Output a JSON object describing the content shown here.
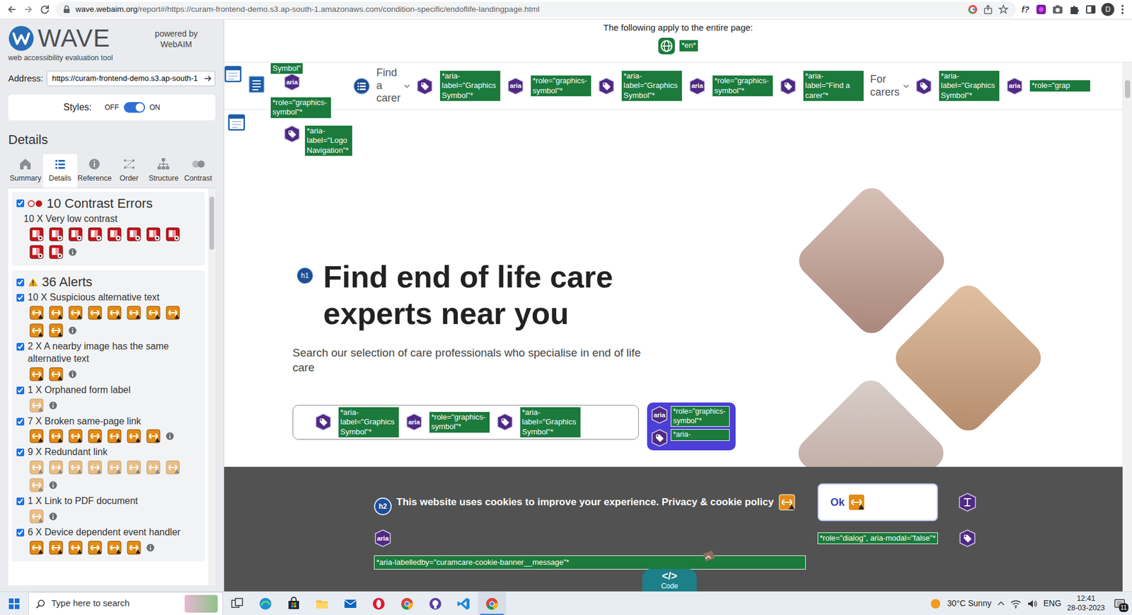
{
  "browser": {
    "url_host": "wave.webaim.org",
    "url_path": "/report#/https://curam-frontend-demo.s3.ap-south-1.amazonaws.com/condition-specific/endoflife-landingpage.html",
    "ext_label": "f?",
    "avatar": "D"
  },
  "wave": {
    "logo": "WAVE",
    "powered_by": "powered by",
    "webaim": "WebAIM",
    "tagline": "web accessibility evaluation tool",
    "address_label": "Address:",
    "address_value": "https://curam-frontend-demo.s3.ap-south-1",
    "styles_label": "Styles:",
    "styles_off": "OFF",
    "styles_on": "ON",
    "styles_enabled": true,
    "details_title": "Details",
    "tabs": [
      {
        "label": "Summary",
        "kind": "home",
        "selected": false
      },
      {
        "label": "Details",
        "kind": "list",
        "selected": true
      },
      {
        "label": "Reference",
        "kind": "info",
        "selected": false
      },
      {
        "label": "Order",
        "kind": "order",
        "selected": false
      },
      {
        "label": "Structure",
        "kind": "structure",
        "selected": false
      },
      {
        "label": "Contrast",
        "kind": "contrast",
        "selected": false
      }
    ],
    "groups": [
      {
        "title": "10 Contrast Errors",
        "kind": "error",
        "checked": true,
        "items": [
          {
            "kind": "plain",
            "label": "10 X Very low contrast",
            "icons": 10,
            "faded": false
          }
        ]
      },
      {
        "title": "36 Alerts",
        "kind": "alert",
        "checked": true,
        "items": [
          {
            "kind": "checkbox",
            "checked": true,
            "label": "10 X Suspicious alternative text",
            "icons": 10,
            "faded": false
          },
          {
            "kind": "checkbox",
            "checked": true,
            "label": "2 X A nearby image has the same alternative text",
            "icons": 2,
            "faded": false
          },
          {
            "kind": "checkbox",
            "checked": true,
            "label": "1 X Orphaned form label",
            "icons": 1,
            "faded": true
          },
          {
            "kind": "checkbox",
            "checked": true,
            "label": "7 X Broken same-page link",
            "icons": 7,
            "faded": false
          },
          {
            "kind": "checkbox",
            "checked": true,
            "label": "9 X Redundant link",
            "icons": 9,
            "faded": true
          },
          {
            "kind": "checkbox",
            "checked": true,
            "label": "1 X Link to PDF document",
            "icons": 1,
            "faded": true
          },
          {
            "kind": "checkbox",
            "checked": true,
            "label": "6 X Device dependent event handler",
            "icons": 6,
            "faded": false
          }
        ]
      }
    ]
  },
  "page": {
    "notice": "The following apply to the entire page:",
    "lang": "*en*",
    "logo_tokens": [
      {
        "kind": "landmark"
      },
      {
        "kind": "label",
        "text": "Symbol\""
      },
      {
        "kind": "doc"
      },
      {
        "kind": "aria",
        "text": "aria"
      },
      {
        "kind": "label",
        "text": "*role=\"graphics-symbol\"*"
      },
      {
        "kind": "landmark"
      },
      {
        "kind": "tag"
      },
      {
        "kind": "label",
        "text": "*aria-label=\"Logo Navigation\"*"
      }
    ],
    "nav_tokens": [
      {
        "kind": "list"
      },
      {
        "kind": "nav",
        "text": "Find a carer"
      },
      {
        "kind": "tag"
      },
      {
        "kind": "label",
        "text": "*aria-label=\"Graphics Symbol\"*"
      },
      {
        "kind": "aria",
        "text": "aria"
      },
      {
        "kind": "label",
        "text": "*role=\"graphics-symbol\"*"
      },
      {
        "kind": "tag"
      },
      {
        "kind": "label",
        "text": "*aria-label=\"Graphics Symbol\"*"
      },
      {
        "kind": "aria",
        "text": "aria"
      },
      {
        "kind": "label",
        "text": "*role=\"graphics-symbol\"*"
      },
      {
        "kind": "tag"
      },
      {
        "kind": "label",
        "text": "*aria-label=\"Find a carer\"*"
      },
      {
        "kind": "nav",
        "text": "For carers"
      },
      {
        "kind": "tag"
      },
      {
        "kind": "label",
        "text": "*aria-label=\"Graphics Symbol\"*"
      },
      {
        "kind": "aria",
        "text": "aria"
      },
      {
        "kind": "label",
        "text": "*role=\"grap"
      }
    ],
    "hero": {
      "badge": "h1",
      "heading": "Find end of life care experts near you",
      "subtitle": "Search our selection of care professionals who specialise in end of life care",
      "search_tokens": [
        {
          "kind": "tag"
        },
        {
          "kind": "label",
          "text": "*aria-label=\"Graphics Symbol\"*"
        },
        {
          "kind": "aria",
          "text": "aria"
        },
        {
          "kind": "label",
          "text": "*role=\"graphics-symbol\"*"
        },
        {
          "kind": "tag"
        },
        {
          "kind": "label",
          "text": "*aria-label=\"Graphics Symbol\"*"
        }
      ],
      "button_tokens": [
        {
          "kind": "aria",
          "text": "aria"
        },
        {
          "kind": "label",
          "text": "*role=\"graphics-symbol\"*"
        },
        {
          "kind": "tag"
        },
        {
          "kind": "label",
          "text": "*aria-"
        }
      ]
    },
    "cookie": {
      "badge": "h2",
      "message": "This website uses cookies to improve your experience.",
      "link": "Privacy & cookie policy",
      "ok": "Ok",
      "aria_badge": "aria",
      "dialog_tag": "*role=\"dialog\", aria-modal=\"false\"*",
      "labelledby_tag": "*aria-labelledby=\"curamcare-cookie-banner__message\"*",
      "code_glyph": "</>",
      "code_label": "Code"
    }
  },
  "taskbar": {
    "search": "Type here to search",
    "apps": [
      {
        "kind": "taskview",
        "active": false
      },
      {
        "kind": "edge",
        "active": false
      },
      {
        "kind": "store",
        "active": false
      },
      {
        "kind": "explorer",
        "active": false
      },
      {
        "kind": "mail",
        "active": false
      },
      {
        "kind": "opera",
        "active": false
      },
      {
        "kind": "chrome",
        "active": false
      },
      {
        "kind": "github",
        "active": false
      },
      {
        "kind": "vscode",
        "active": false
      },
      {
        "kind": "chrome",
        "active": true
      }
    ],
    "weather": "30°C Sunny",
    "lang": "ENG",
    "time": "12:41",
    "date": "28-03-2023",
    "notifications": "11"
  }
}
